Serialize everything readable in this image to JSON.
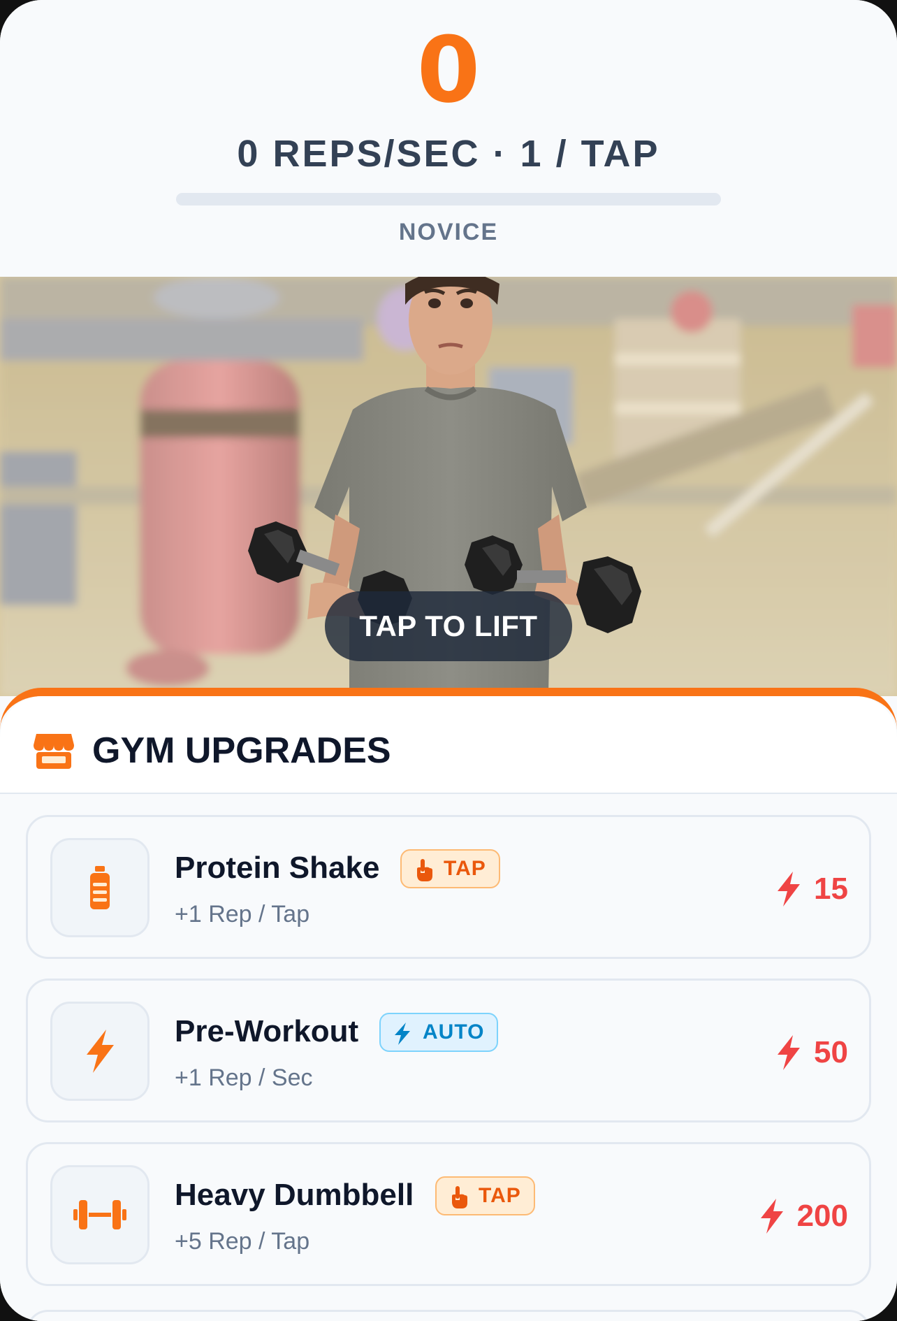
{
  "stats": {
    "reps": "0",
    "rate_line": "0 REPS/SEC · 1 / TAP",
    "rank": "NOVICE",
    "rank_progress": 0
  },
  "scene": {
    "tap_prompt": "TAP TO LIFT"
  },
  "shop": {
    "title": "GYM UPGRADES",
    "icon": "store-icon",
    "upgrades": [
      {
        "name": "Protein Shake",
        "badge": "TAP",
        "badge_icon": "pointer-hand-icon",
        "desc": "+1 Rep / Tap",
        "cost": "15",
        "icon": "bottle-icon"
      },
      {
        "name": "Pre-Workout",
        "badge": "AUTO",
        "badge_icon": "bolt-icon",
        "desc": "+1 Rep / Sec",
        "cost": "50",
        "icon": "bolt-icon"
      },
      {
        "name": "Heavy Dumbbell",
        "badge": "TAP",
        "badge_icon": "pointer-hand-icon",
        "desc": "+5 Rep / Tap",
        "cost": "200",
        "icon": "dumbbell-icon"
      }
    ]
  },
  "colors": {
    "accent": "#f97316",
    "cost": "#ef4444",
    "tap_badge": "#ea580c",
    "auto_badge": "#0284c7"
  }
}
